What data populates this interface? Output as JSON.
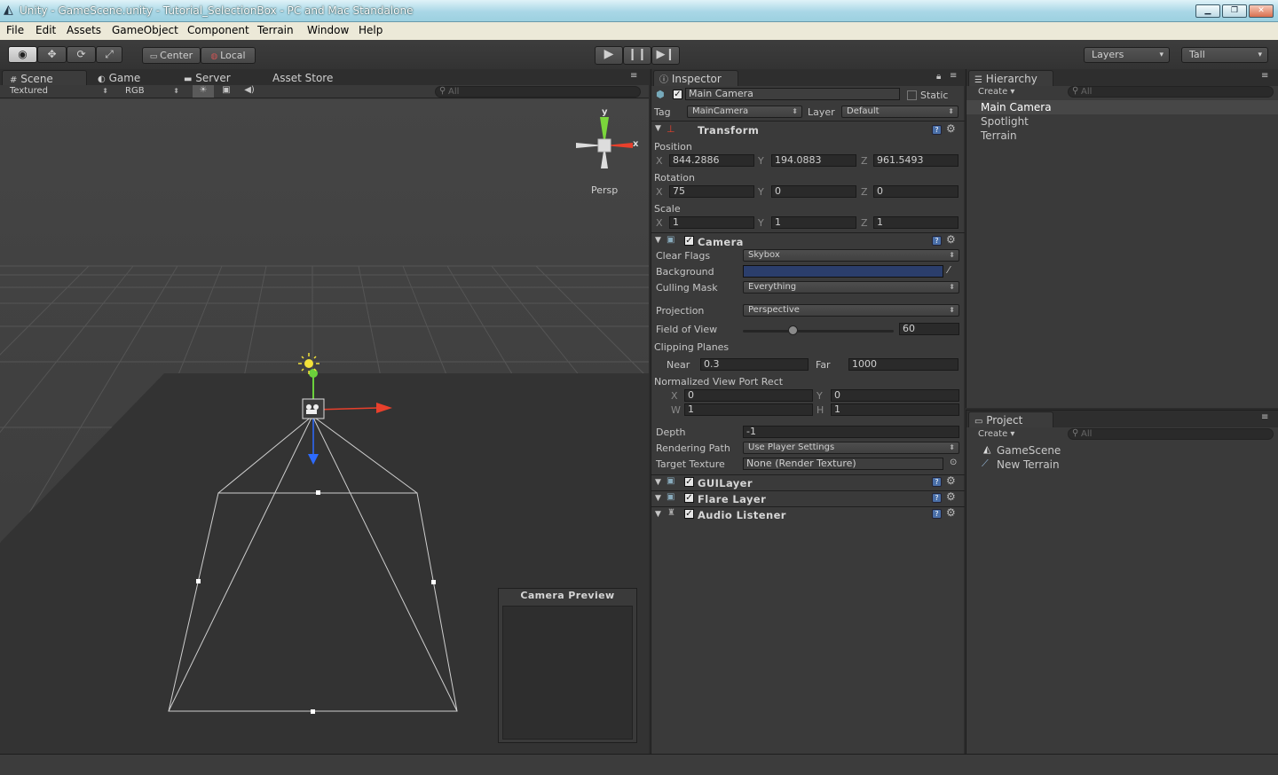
{
  "window": {
    "title": "Unity - GameScene.unity - Tutorial_SelectionBox - PC and Mac Standalone",
    "min": "▁",
    "max": "❐",
    "close": "✕"
  },
  "menu": [
    "File",
    "Edit",
    "Assets",
    "GameObject",
    "Component",
    "Terrain",
    "Window",
    "Help"
  ],
  "toolbar": {
    "center": "Center",
    "local": "Local",
    "layers": "Layers",
    "layout": "Tall"
  },
  "scene": {
    "tabs": [
      "Scene",
      "Game",
      "Server",
      "Asset Store"
    ],
    "render_mode": "Textured",
    "color_mode": "RGB",
    "search_placeholder": "All",
    "persp": "Persp",
    "axis_x": "x",
    "axis_y": "y",
    "camera_preview": "Camera Preview"
  },
  "inspector": {
    "tab": "Inspector",
    "object_name": "Main Camera",
    "static_label": "Static",
    "tag_label": "Tag",
    "tag_value": "MainCamera",
    "layer_label": "Layer",
    "layer_value": "Default",
    "transform": {
      "title": "Transform",
      "position_label": "Position",
      "position": {
        "x": "844.2886",
        "y": "194.0883",
        "z": "961.5493"
      },
      "rotation_label": "Rotation",
      "rotation": {
        "x": "75",
        "y": "0",
        "z": "0"
      },
      "scale_label": "Scale",
      "scale": {
        "x": "1",
        "y": "1",
        "z": "1"
      },
      "x": "X",
      "y": "Y",
      "z": "Z"
    },
    "camera": {
      "title": "Camera",
      "clear_flags_label": "Clear Flags",
      "clear_flags": "Skybox",
      "background_label": "Background",
      "background_color": "#2b3e6c",
      "culling_mask_label": "Culling Mask",
      "culling_mask": "Everything",
      "projection_label": "Projection",
      "projection": "Perspective",
      "fov_label": "Field of View",
      "fov": "60",
      "fov_fraction": 0.33,
      "clipping_label": "Clipping Planes",
      "near_label": "Near",
      "near": "0.3",
      "far_label": "Far",
      "far": "1000",
      "viewport_label": "Normalized View Port Rect",
      "vp_x_label": "X",
      "vp_x": "0",
      "vp_y_label": "Y",
      "vp_y": "0",
      "vp_w_label": "W",
      "vp_w": "1",
      "vp_h_label": "H",
      "vp_h": "1",
      "depth_label": "Depth",
      "depth": "-1",
      "rendering_path_label": "Rendering Path",
      "rendering_path": "Use Player Settings",
      "target_texture_label": "Target Texture",
      "target_texture": "None (Render Texture)"
    },
    "components": [
      "GUILayer",
      "Flare Layer",
      "Audio Listener"
    ]
  },
  "hierarchy": {
    "tab": "Hierarchy",
    "create": "Create",
    "search_placeholder": "All",
    "items": [
      "Main Camera",
      "Spotlight",
      "Terrain"
    ]
  },
  "project": {
    "tab": "Project",
    "create": "Create",
    "search_placeholder": "All",
    "items": [
      "GameScene",
      "New Terrain"
    ]
  }
}
